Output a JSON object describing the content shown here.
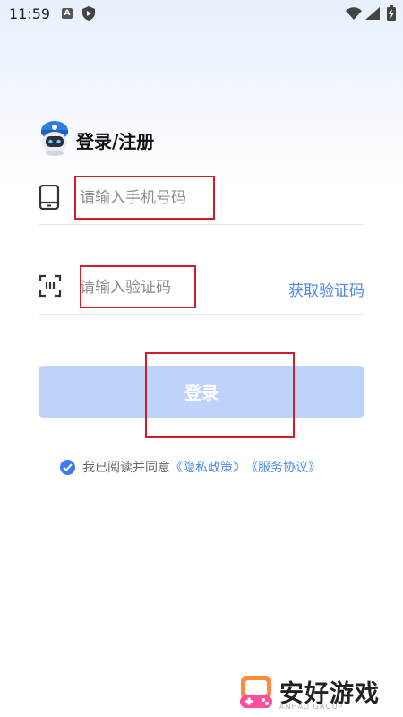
{
  "status_bar": {
    "time": "11:59",
    "notif_badge": "A"
  },
  "header": {
    "title": "登录/注册"
  },
  "phone_field": {
    "placeholder": "请输入手机号码",
    "value": ""
  },
  "code_field": {
    "placeholder": "请输入验证码",
    "value": "",
    "get_code_label": "获取验证码"
  },
  "login_button": {
    "label": "登录"
  },
  "agreement": {
    "prefix": "我已阅读并同意",
    "privacy_link": "《隐私政策》",
    "service_link": "《服务协议》",
    "checked": true
  },
  "watermark": {
    "text": "安好游戏",
    "sub": "ANHAO GROUP"
  },
  "colors": {
    "accent": "#4c8ae6",
    "button_disabled": "#bdd3fa",
    "highlight": "#cc1f2b"
  }
}
